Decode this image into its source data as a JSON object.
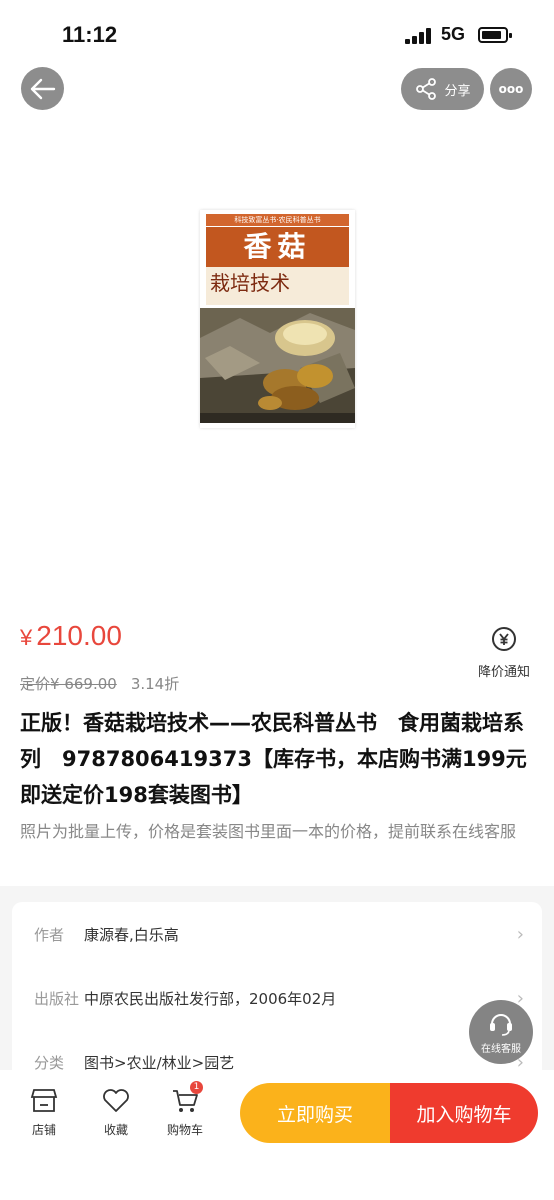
{
  "status_bar": {
    "time": "11:12",
    "network": "5G"
  },
  "nav": {
    "share_label": "分享",
    "more_label": "ooo"
  },
  "cover": {
    "series": "科技致富丛书·农民科普丛书",
    "title": "香菇",
    "subtitle": "栽培技术"
  },
  "price": {
    "currency": "¥",
    "amount": "210.00"
  },
  "price_alert": {
    "label": "降价通知"
  },
  "list_price": {
    "label": "定价",
    "value": "¥ 669.00",
    "discount": "3.14折"
  },
  "product": {
    "title": "正版！香菇栽培技术——农民科普丛书　食用菌栽培系列　9787806419373【库存书，本店购书满199元即送定价198套装图书】",
    "description": "照片为批量上传，价格是套装图书里面一本的价格，提前联系在线客服"
  },
  "info": {
    "rows": [
      {
        "key": "作者",
        "value": "康源春,白乐高"
      },
      {
        "key": "出版社",
        "value": "中原农民出版社发行部，2006年02月"
      },
      {
        "key": "分类",
        "value": "图书>农业/林业>园艺"
      }
    ]
  },
  "service": {
    "label": "在线客服"
  },
  "bottom": {
    "tabs": [
      {
        "label": "店铺",
        "icon": "store-icon"
      },
      {
        "label": "收藏",
        "icon": "heart-icon"
      },
      {
        "label": "购物车",
        "icon": "cart-icon"
      }
    ],
    "cart_count": "1",
    "buy_now": "立即购买",
    "add_cart": "加入购物车"
  },
  "colors": {
    "accent": "#e8473c",
    "buy_now": "#fbb21b",
    "add_cart": "#ef3b2e"
  }
}
